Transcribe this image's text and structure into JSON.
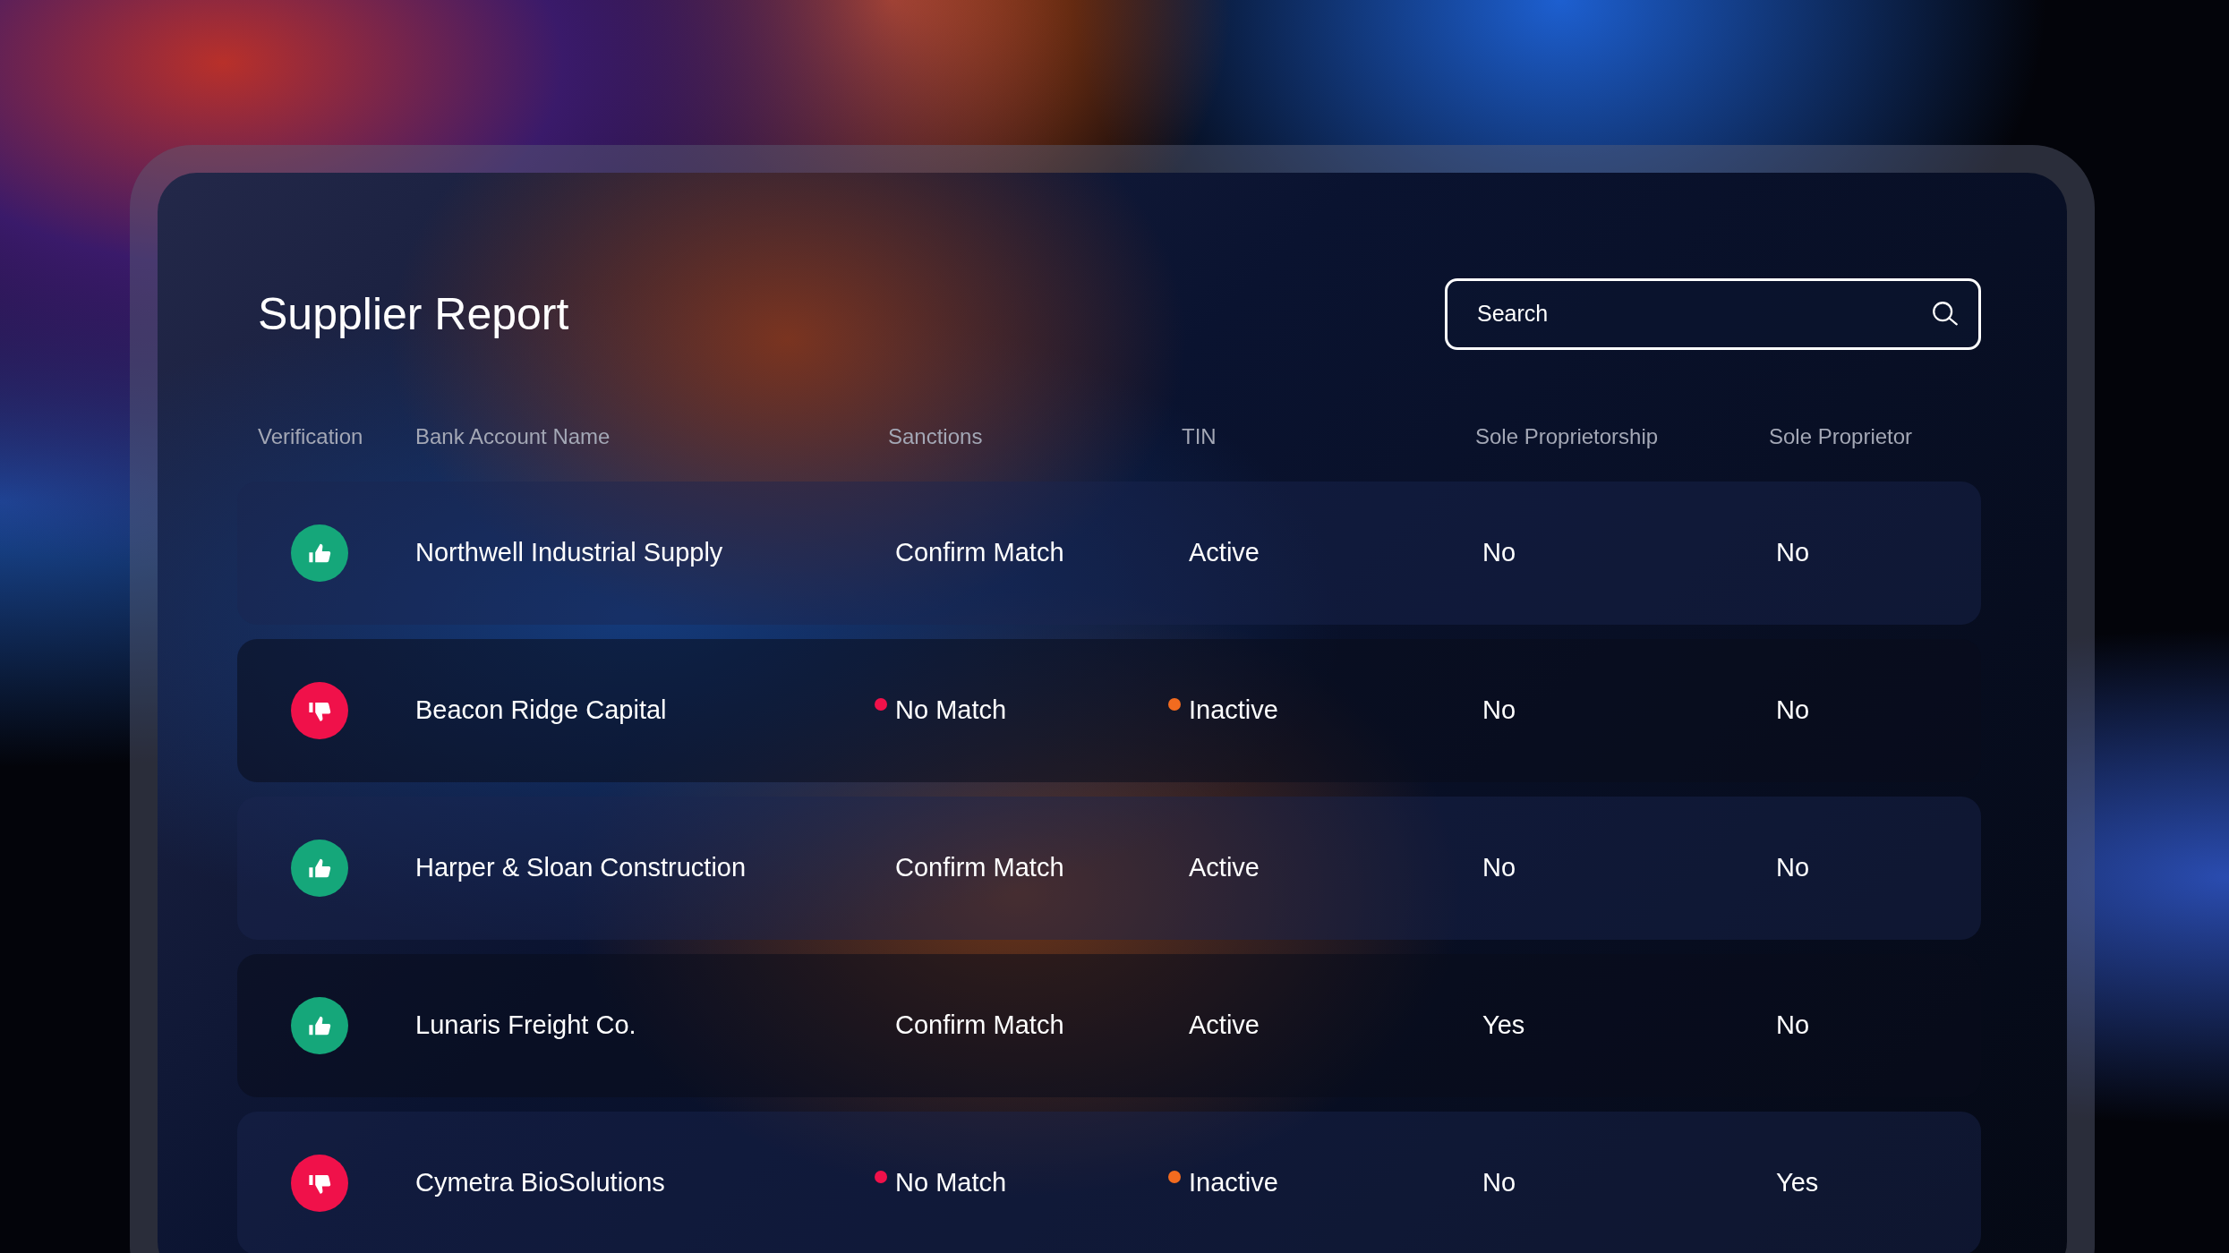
{
  "title": "Supplier Report",
  "search": {
    "placeholder": "Search"
  },
  "columns": [
    "Verification",
    "Bank Account Name",
    "Sanctions",
    "TIN",
    "Sole Proprietorship",
    "Sole Proprietor"
  ],
  "rows": [
    {
      "verified": true,
      "name": "Northwell Industrial Supply",
      "sanctions": {
        "text": "Confirm Match",
        "flagged": false
      },
      "tin": {
        "text": "Active",
        "flagged": false
      },
      "sole_proprietorship": "No",
      "sole_proprietor": "No"
    },
    {
      "verified": false,
      "name": "Beacon Ridge Capital",
      "sanctions": {
        "text": "No Match",
        "flagged": true
      },
      "tin": {
        "text": "Inactive",
        "flagged": true
      },
      "sole_proprietorship": "No",
      "sole_proprietor": "No"
    },
    {
      "verified": true,
      "name": "Harper & Sloan Construction",
      "sanctions": {
        "text": "Confirm Match",
        "flagged": false
      },
      "tin": {
        "text": "Active",
        "flagged": false
      },
      "sole_proprietorship": "No",
      "sole_proprietor": "No"
    },
    {
      "verified": true,
      "name": "Lunaris Freight Co.",
      "sanctions": {
        "text": "Confirm Match",
        "flagged": false
      },
      "tin": {
        "text": "Active",
        "flagged": false
      },
      "sole_proprietorship": "Yes",
      "sole_proprietor": "No"
    },
    {
      "verified": false,
      "name": "Cymetra BioSolutions",
      "sanctions": {
        "text": "No Match",
        "flagged": true
      },
      "tin": {
        "text": "Inactive",
        "flagged": true
      },
      "sole_proprietorship": "No",
      "sole_proprietor": "Yes"
    }
  ]
}
